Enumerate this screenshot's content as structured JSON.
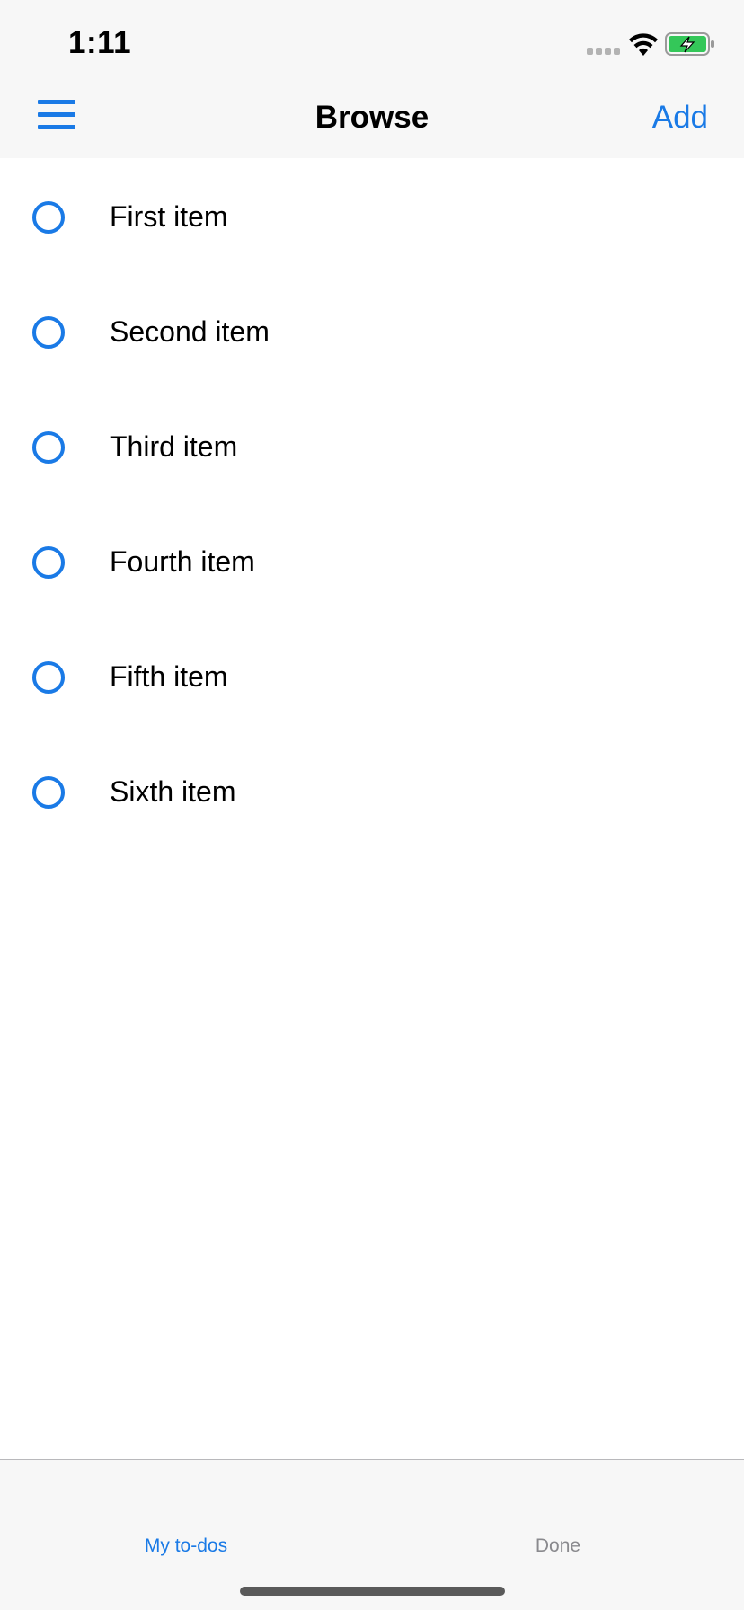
{
  "status_bar": {
    "time": "1:11",
    "signal_icon": "signal-dots-icon",
    "wifi_icon": "wifi-icon",
    "battery_icon": "battery-charging-icon",
    "battery_color": "#34c759"
  },
  "nav_bar": {
    "menu_icon": "hamburger-menu-icon",
    "title": "Browse",
    "add_label": "Add"
  },
  "todos": [
    {
      "label": "First item",
      "checked": false
    },
    {
      "label": "Second item",
      "checked": false
    },
    {
      "label": "Third item",
      "checked": false
    },
    {
      "label": "Fourth item",
      "checked": false
    },
    {
      "label": "Fifth item",
      "checked": false
    },
    {
      "label": "Sixth item",
      "checked": false
    }
  ],
  "tab_bar": {
    "tabs": [
      {
        "label": "My to-dos",
        "selected": true
      },
      {
        "label": "Done",
        "selected": false
      }
    ]
  },
  "colors": {
    "accent": "#1a7ae6",
    "bar_background": "#f7f7f7",
    "inactive_tab": "#8a8a8e"
  }
}
